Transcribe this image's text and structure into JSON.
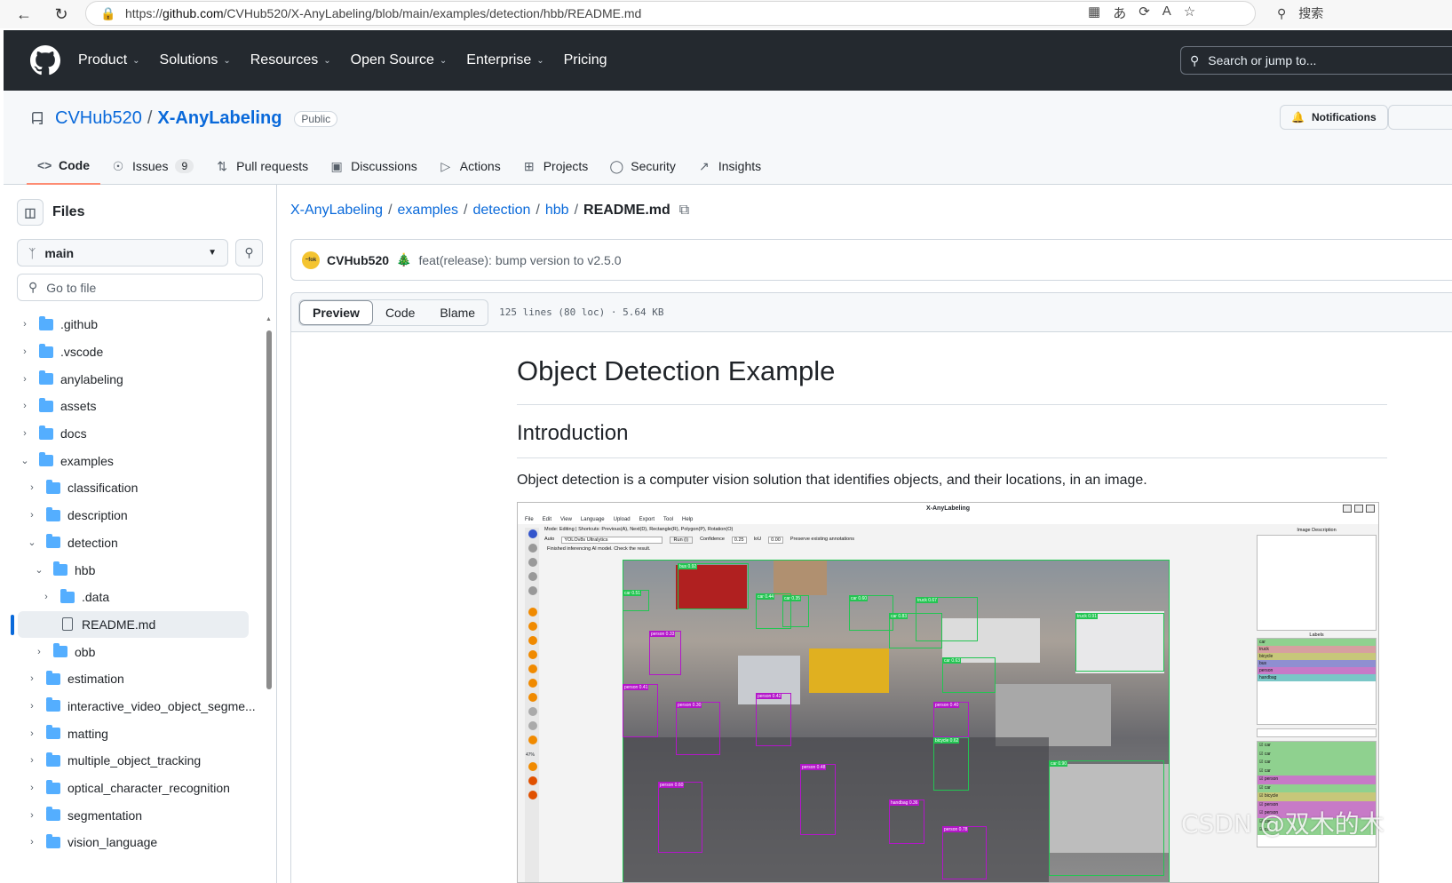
{
  "browser": {
    "url_prefix": "https://",
    "url_host": "github.com",
    "url_path": "/CVHub520/X-AnyLabeling/blob/main/examples/detection/hbb/README.md",
    "search_label": "搜索"
  },
  "gh_nav": {
    "items": [
      {
        "label": "Product",
        "has_menu": true
      },
      {
        "label": "Solutions",
        "has_menu": true
      },
      {
        "label": "Resources",
        "has_menu": true
      },
      {
        "label": "Open Source",
        "has_menu": true
      },
      {
        "label": "Enterprise",
        "has_menu": true
      },
      {
        "label": "Pricing",
        "has_menu": false
      }
    ],
    "search_placeholder": "Search or jump to..."
  },
  "repo": {
    "owner": "CVHub520",
    "separator": "/",
    "name": "X-AnyLabeling",
    "visibility": "Public",
    "notifications_label": "Notifications",
    "tabs": [
      {
        "label": "Code",
        "icon": "code-icon",
        "active": true
      },
      {
        "label": "Issues",
        "icon": "issue-icon",
        "count": "9"
      },
      {
        "label": "Pull requests",
        "icon": "pull-request-icon"
      },
      {
        "label": "Discussions",
        "icon": "discussion-icon"
      },
      {
        "label": "Actions",
        "icon": "play-icon"
      },
      {
        "label": "Projects",
        "icon": "table-icon"
      },
      {
        "label": "Security",
        "icon": "shield-icon"
      },
      {
        "label": "Insights",
        "icon": "graph-icon"
      }
    ]
  },
  "sidebar": {
    "title": "Files",
    "branch": "main",
    "goto_placeholder": "Go to file",
    "tree": [
      {
        "label": ".github",
        "type": "folder",
        "depth": 0,
        "open": false
      },
      {
        "label": ".vscode",
        "type": "folder",
        "depth": 0,
        "open": false
      },
      {
        "label": "anylabeling",
        "type": "folder",
        "depth": 0,
        "open": false
      },
      {
        "label": "assets",
        "type": "folder",
        "depth": 0,
        "open": false
      },
      {
        "label": "docs",
        "type": "folder",
        "depth": 0,
        "open": false
      },
      {
        "label": "examples",
        "type": "folder",
        "depth": 0,
        "open": true
      },
      {
        "label": "classification",
        "type": "folder",
        "depth": 1,
        "open": false
      },
      {
        "label": "description",
        "type": "folder",
        "depth": 1,
        "open": false
      },
      {
        "label": "detection",
        "type": "folder",
        "depth": 1,
        "open": true
      },
      {
        "label": "hbb",
        "type": "folder",
        "depth": 2,
        "open": true
      },
      {
        "label": ".data",
        "type": "folder",
        "depth": 3,
        "open": false
      },
      {
        "label": "README.md",
        "type": "file",
        "depth": 3,
        "selected": true
      },
      {
        "label": "obb",
        "type": "folder",
        "depth": 2,
        "open": false
      },
      {
        "label": "estimation",
        "type": "folder",
        "depth": 1,
        "open": false
      },
      {
        "label": "interactive_video_object_segme...",
        "type": "folder",
        "depth": 1,
        "open": false
      },
      {
        "label": "matting",
        "type": "folder",
        "depth": 1,
        "open": false
      },
      {
        "label": "multiple_object_tracking",
        "type": "folder",
        "depth": 1,
        "open": false
      },
      {
        "label": "optical_character_recognition",
        "type": "folder",
        "depth": 1,
        "open": false
      },
      {
        "label": "segmentation",
        "type": "folder",
        "depth": 1,
        "open": false
      },
      {
        "label": "vision_language",
        "type": "folder",
        "depth": 1,
        "open": false
      }
    ]
  },
  "breadcrumb": {
    "parts": [
      "X-AnyLabeling",
      "examples",
      "detection",
      "hbb"
    ],
    "current": "README.md"
  },
  "commit": {
    "avatar_text": "~fok",
    "author": "CVHub520",
    "message": "feat(release): bump version to v2.5.0"
  },
  "file_view": {
    "tabs": [
      "Preview",
      "Code",
      "Blame"
    ],
    "active_tab": "Preview",
    "meta": "125 lines (80 loc) · 5.64 KB"
  },
  "readme": {
    "h1": "Object Detection Example",
    "h2": "Introduction",
    "paragraph": "Object detection is a computer vision solution that identifies objects, and their locations, in an image."
  },
  "app_screenshot": {
    "title": "X-AnyLabeling",
    "menu": [
      "File",
      "Edit",
      "View",
      "Language",
      "Upload",
      "Export",
      "Tool",
      "Help"
    ],
    "mode_line": "Mode: Editing | Shortcuts: Previous(A), Next(D), Rectangle(R), Polygon(P), Rotation(O)",
    "auto_label": "Auto",
    "model": "YOLOv8s Ultralytics",
    "run_label": "Run (i)",
    "confidence_label": "Confidence",
    "confidence": "0.25",
    "iou_label": "IoU",
    "iou": "0.00",
    "preserve_label": "Preserve existing annotations",
    "status": "Finished inferencing AI model. Check the result.",
    "zoom": "47%",
    "image_description_label": "Image Description",
    "labels_title": "Labels",
    "labels": [
      {
        "name": "car",
        "color": "#8fd18f"
      },
      {
        "name": "truck",
        "color": "#d6a0a0"
      },
      {
        "name": "bicycle",
        "color": "#c7c77a"
      },
      {
        "name": "bus",
        "color": "#8f8fd1"
      },
      {
        "name": "person",
        "color": "#c77ac7"
      },
      {
        "name": "handbag",
        "color": "#7ac7c7"
      }
    ],
    "shape_list": [
      "car",
      "car",
      "car",
      "car",
      "person",
      "car",
      "bicycle",
      "person",
      "person",
      "car",
      "car"
    ],
    "box_labels": [
      "bus 0.92",
      "car 0.51",
      "car 0.44",
      "car 0.35",
      "car 0.60",
      "truck 0.67",
      "car 0.83",
      "truck 0.91",
      "car 0.63",
      "person 0.33",
      "person 0.41",
      "person 0.42",
      "person 0.40",
      "person 0.30",
      "car 0.90",
      "bicycle 0.62",
      "person 0.48",
      "handbag 0.36",
      "person 0.60",
      "person 0.78"
    ]
  },
  "watermark": "CSDN @双木的木"
}
